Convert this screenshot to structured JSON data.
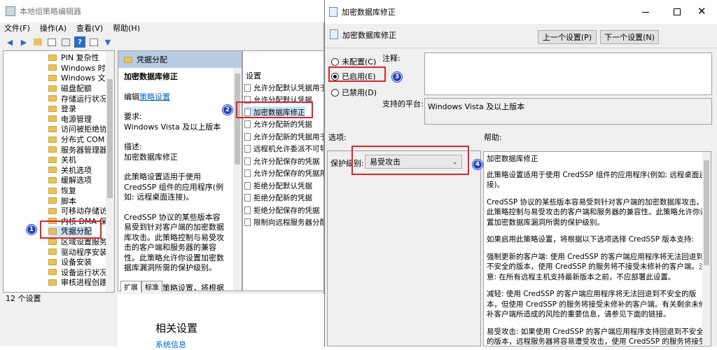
{
  "main_window": {
    "title": "本地组策略编辑器",
    "menu": [
      "文件(F)",
      "操作(A)",
      "查看(V)",
      "帮助(H)"
    ],
    "tree_items": [
      "PIN 复杂性",
      "Windows 时间服",
      "Windows 文件保",
      "磁盘配额",
      "存储运行状况",
      "登录",
      "电源管理",
      "访问被拒绝协助",
      "分布式 COM",
      "服务器管理器",
      "关机",
      "关机选项",
      "缓解选项",
      "恢复",
      "脚本",
      "可移动存储访问",
      "内核 DMA 保护",
      "凭据分配",
      "区域设置服务",
      "驱动程序安装",
      "设备安装",
      "设备运行状况证",
      "审核进程创建"
    ],
    "selected_tree_item": "凭据分配",
    "status": "12 个设置",
    "header": "凭据分配",
    "desc_title": "加密数据库修正",
    "edit_prefix": "编辑",
    "edit_link": "策略设置",
    "req_label": "要求:",
    "req_value": "Windows Vista 及以上版本",
    "desc_label": "描述:",
    "desc_value": "加密数据库修正",
    "desc_para1": "此策略设置适用于使用 CredSSP 组件的应用程序(例如: 远程桌面连接)。",
    "desc_para2": "CredSSP 协议的某些版本容易受到针对客户端的加密数据库攻击。此策略控制与易受攻击的客户端和服务器的兼容性。此策略允许你设置加密数据库漏洞所需的保护级别。",
    "desc_para3": "如果启用此策略设置，将根据以下选项选择 CredSSP 版本支持:",
    "settings_header": "设置",
    "settings": [
      "允许分配默认凭据用于仅",
      "允许分配默认凭据",
      "加密数据库修正",
      "允许分配新的凭据",
      "允许分配新的凭据用于仅",
      "远程机允许委派不可导出",
      "允许分配保存的凭据",
      "允许分配保存的凭据用于",
      "拒绝分配默认凭据",
      "拒绝分配新的凭据",
      "拒绝分配保存的凭据",
      "限制向远程服务器分配凭"
    ],
    "selected_setting": "加密数据库修正",
    "tabs": [
      "扩展",
      "标准"
    ],
    "bg_heading": "相关设置",
    "bg_link": "系统信息"
  },
  "dialog": {
    "title": "加密数据库修正",
    "header": "加密数据库修正",
    "prev_button": "上一个设置(P)",
    "next_button": "下一个设置(N)",
    "radio_not_configured": "未配置(C)",
    "radio_enabled": "已启用(E)",
    "radio_disabled": "已禁用(D)",
    "comment_label": "注释:",
    "platform_label": "支持的平台:",
    "platform_value": "Windows Vista 及以上版本",
    "options_label": "选项:",
    "help_label": "帮助:",
    "protection_label": "保护级别:",
    "protection_value": "易受攻击",
    "help_title": "加密数据库修正",
    "help_p1": "此策略设置适用于使用 CredSSP 组件的应用程序(例如: 远程桌面连接)。",
    "help_p2": "CredSSP 协议的某些版本容易受到针对客户端的加密数据库攻击。此策略控制与易受攻击的客户端和服务器的兼容性。此策略允许你设置加密数据库漏洞所需的保护级别。",
    "help_p3": "如果启用此策略设置，将根据以下选项选择 CredSSP 版本支持:",
    "help_p4": "强制更新的客户端: 使用 CredSSP 的客户端应用程序将无法回退到不安全的版本，使用 CredSSP 的服务将不接受未修补的客户端。注意: 在所有远程主机支持最新版本之前，不应部署此设置。",
    "help_p5": "减轻: 使用 CredSSP 的客户端应用程序将无法回退到不安全的版本，但使用 CredSSP 的服务将接受未修补的客户端。有关剩余未修补客户端所造成的风险的重要信息，请参见下面的链接。",
    "help_p6": "易受攻击: 如果使用 CredSSP 的客户端应用程序支持回退到不安全的版本，远程服务器将容易遭受攻击，使用 CredSSP 的服务将接受未修补的客户端。"
  },
  "annotations": {
    "b1": "1",
    "b2": "2",
    "b3": "3",
    "b4": "4"
  },
  "colors": {
    "annotation_red": "#d9262e",
    "badge_blue": "#1f3fbf",
    "link_blue": "#0066cc"
  }
}
